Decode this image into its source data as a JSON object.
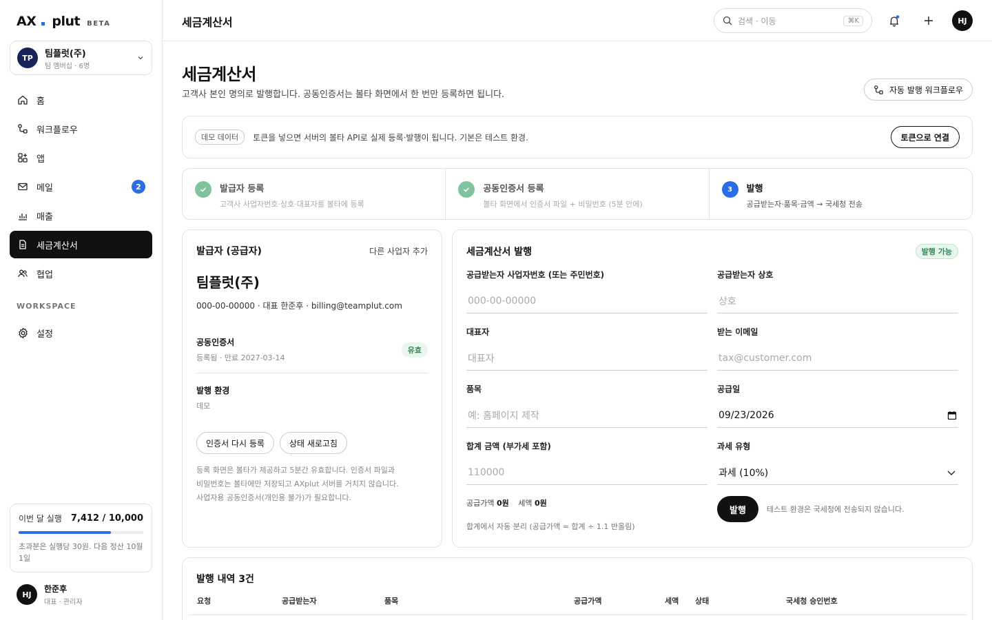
{
  "brand": {
    "ax": "AX",
    "plut": "plut",
    "beta": "BETA"
  },
  "team": {
    "initials": "TP",
    "name": "팀플럿(주)",
    "sub": "팀 멤버십 · 6명"
  },
  "nav": [
    {
      "label": "홈"
    },
    {
      "label": "워크플로우"
    },
    {
      "label": "앱"
    },
    {
      "label": "메일",
      "badge": "2"
    },
    {
      "label": "매출"
    },
    {
      "label": "세금계산서"
    },
    {
      "label": "협업"
    }
  ],
  "workspace": {
    "label": "WORKSPACE",
    "settings": "설정"
  },
  "usage": {
    "label": "이번 달 실행",
    "value": "7,412 / 10,000",
    "progress": 0.7412,
    "note": "초과분은 실행당 30원. 다음 정산 10월 1일"
  },
  "user": {
    "initials": "HJ",
    "name": "한준후",
    "role": "대표 · 관리자"
  },
  "topbar": {
    "title": "세금계산서",
    "search_placeholder": "검색 · 이동",
    "shortcut": "⌘K",
    "avatar": "HJ"
  },
  "page": {
    "title": "세금계산서",
    "lead": "고객사 본인 명의로 발행합니다. 공동인증서는 볼타 화면에서 한 번만 등록하면 됩니다.",
    "auto_workflow": "자동 발행 워크플로우"
  },
  "demo": {
    "tag": "데모 데이터",
    "message": "토큰을 넣으면 서버의 볼타 API로 실제 등록·발행이 됩니다. 기본은 테스트 환경.",
    "button": "토큰으로 연결"
  },
  "steps": [
    {
      "title": "발급자 등록",
      "desc": "고객사 사업자번호·상호·대표자를 볼타에 등록"
    },
    {
      "title": "공동인증서 등록",
      "desc": "볼타 화면에서 인증서 파일 + 비밀번호 (5분 안에)"
    },
    {
      "num": "3",
      "title": "발행",
      "desc": "공급받는자·품목·금액 → 국세청 전송"
    }
  ],
  "issuer": {
    "title": "발급자 (공급자)",
    "add": "다른 사업자 추가",
    "company": "팀플럿(주)",
    "meta": "000-00-00000 · 대표 한준후 · billing@teamplut.com",
    "cert_title": "공동인증서",
    "cert_desc": "등록됨 · 만료 2027-03-14",
    "cert_status": "유효",
    "env_title": "발행 환경",
    "env_value": "데모",
    "btn_reregister": "인증서 다시 등록",
    "btn_refresh": "상태 새로고침",
    "help": [
      "등록 화면은 볼타가 제공하고 5분간 유효합니다. 인증서 파일과",
      "비밀번호는 볼타에만 저장되고 AXplut 서버를 거치지 않습니다.",
      "사업자용 공동인증서(개인용 불가)가 필요합니다."
    ]
  },
  "form": {
    "title": "세금계산서 발행",
    "status": "발행 가능",
    "fields": [
      {
        "label": "공급받는자 사업자번호 (또는 주민번호)",
        "placeholder": "000-00-00000"
      },
      {
        "label": "공급받는자 상호",
        "placeholder": "상호"
      },
      {
        "label": "대표자",
        "placeholder": "대표자"
      },
      {
        "label": "받는 이메일",
        "placeholder": "tax@customer.com"
      },
      {
        "label": "품목",
        "placeholder": "예: 홈페이지 제작"
      },
      {
        "label": "공급일",
        "value": "09/23/2026"
      },
      {
        "label": "합계 금액 (부가세 포함)",
        "placeholder": "110000"
      },
      {
        "label": "과세 유형",
        "value": "과세 (10%)"
      }
    ],
    "supply_label": "공급가액",
    "supply_value": "0원",
    "tax_label": "세액",
    "tax_value": "0원",
    "calc_note": "합계에서 자동 분리 (공급가액 = 합계 ÷ 1.1 반올림)",
    "issue_button": "발행",
    "issue_note": "테스트 환경은 국세청에 전송되지 않습니다."
  },
  "history": {
    "title": "발행 내역 3건",
    "columns": [
      "요청",
      "공급받는자",
      "품목",
      "공급가액",
      "세액",
      "상태",
      "국세청 승인번호"
    ]
  },
  "colors": {
    "accent": "#2b6de8",
    "success": "#2e8a57",
    "step_done": "#7fc49c",
    "dark": "#111111"
  }
}
